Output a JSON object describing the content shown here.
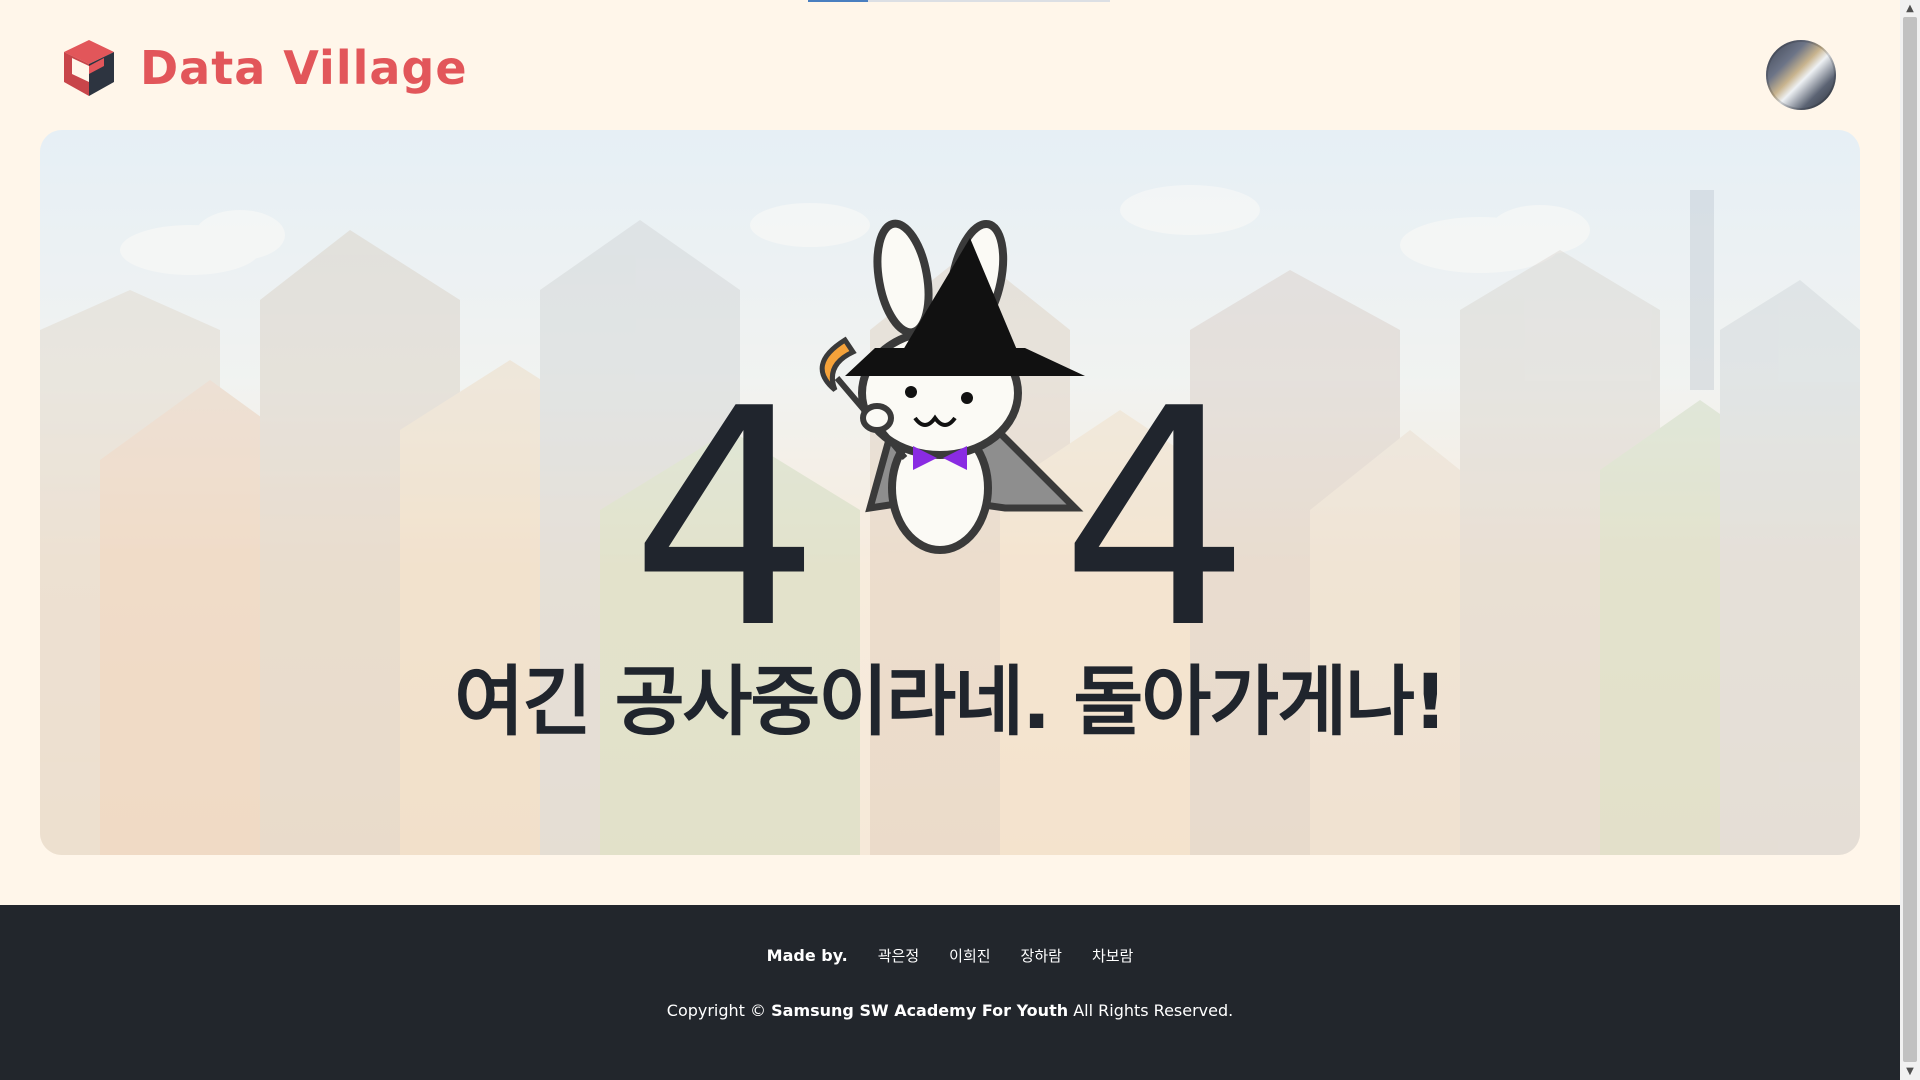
{
  "brand": {
    "name": "Data Village",
    "color": "#e2565a"
  },
  "user": {
    "avatar_icon": "profile-avatar"
  },
  "loading": {
    "progress": 0.2
  },
  "error": {
    "code_left": "4",
    "code_right": "4",
    "mascot_icon": "witch-rabbit-mascot",
    "message": "여긴 공사중이라네. 돌아가게나!"
  },
  "footer": {
    "made_by_label": "Made by.",
    "members": [
      "곽은정",
      "이희진",
      "장하람",
      "차보람"
    ],
    "copyright_prefix": "Copyright ©",
    "copyright_org": "Samsung SW Academy For Youth",
    "copyright_suffix": "All Rights Reserved."
  },
  "colors": {
    "background": "#fff6ea",
    "footer": "#22262c",
    "text_dark": "#20252d"
  }
}
